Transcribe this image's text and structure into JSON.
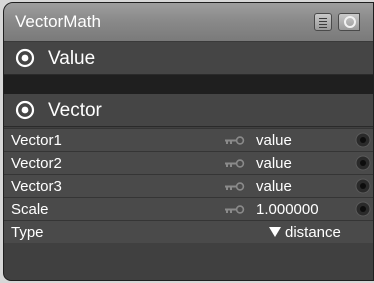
{
  "node": {
    "title": "VectorMath",
    "groups": [
      {
        "label": "Value"
      },
      {
        "label": "Vector"
      }
    ],
    "params": [
      {
        "label": "Vector1",
        "value": "value"
      },
      {
        "label": "Vector2",
        "value": "value"
      },
      {
        "label": "Vector3",
        "value": "value"
      },
      {
        "label": "Scale",
        "value": "1.000000"
      }
    ],
    "type": {
      "label": "Type",
      "value": "distance"
    }
  },
  "icons": {
    "list": "list-icon",
    "preview": "preview-icon",
    "disclosure": "disclosure-icon",
    "key": "key-icon",
    "socket": "socket-icon",
    "dropdown": "dropdown-arrow-icon"
  },
  "colors": {
    "titlebar": "#8a8a8a",
    "body": "#404040",
    "row": "#4a4a4a",
    "text": "#ffffff",
    "socket": "#1a1a1a"
  }
}
